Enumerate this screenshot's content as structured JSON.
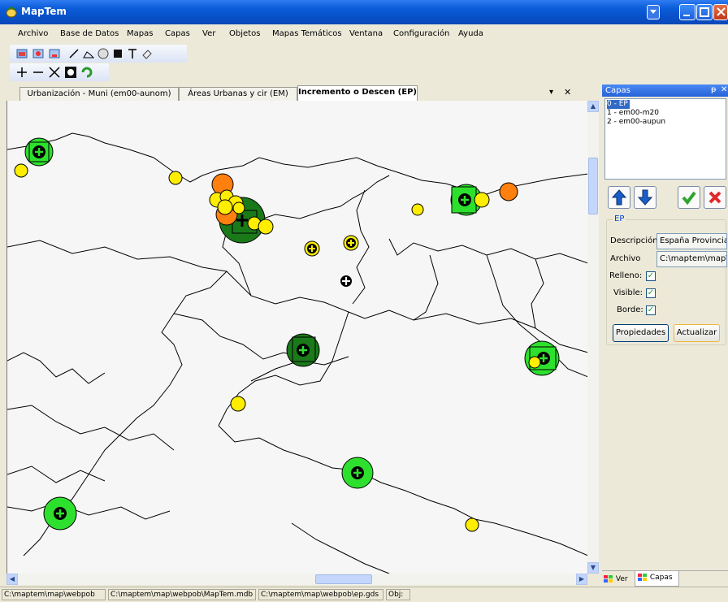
{
  "window": {
    "title": "MapTem"
  },
  "menu": [
    "Archivo",
    "Base de Datos",
    "Mapas",
    "Capas",
    "Ver",
    "Objetos",
    "Mapas Temáticos",
    "Ventana",
    "Configuración",
    "Ayuda"
  ],
  "tabs": [
    {
      "label": "Urbanización - Muni (em00-aunom)",
      "active": false
    },
    {
      "label": "Áreas Urbanas y cir (EM)",
      "active": false
    },
    {
      "label": "Incremento o Descen (EP)",
      "active": true
    }
  ],
  "tab_controls": {
    "dropdown": "▾",
    "close": "✕"
  },
  "panel": {
    "title": "Capas",
    "pin": "ᵽ",
    "close": "✕",
    "layers": [
      "0 - EP",
      "1 - em00-m20",
      "2 - em00-aupun"
    ],
    "selected_layer": "0 - EP",
    "group_label": "EP",
    "descripcion_label": "Descripción",
    "descripcion_value": "España Provincia",
    "archivo_label": "Archivo",
    "archivo_value": "C:\\maptem\\map\\",
    "relleno_label": "Relleno:",
    "visible_label": "Visible:",
    "borde_label": "Borde:",
    "relleno": true,
    "visible": true,
    "borde": true,
    "propiedades_button": "Propiedades",
    "actualizar_button": "Actualizar",
    "bottom_tabs": [
      "Ver",
      "Capas"
    ]
  },
  "status": [
    "C:\\maptem\\map\\webpob",
    "C:\\maptem\\map\\webpob\\MapTem.mdb",
    "C:\\maptem\\map\\webpob\\ep.gds",
    "Obj:"
  ],
  "colors": {
    "green_large": "#1a7a1a",
    "green_medium": "#2ee02e",
    "orange": "#ff7f0f",
    "yellow": "#ffee00",
    "titlebar": "#0a5cd8"
  }
}
